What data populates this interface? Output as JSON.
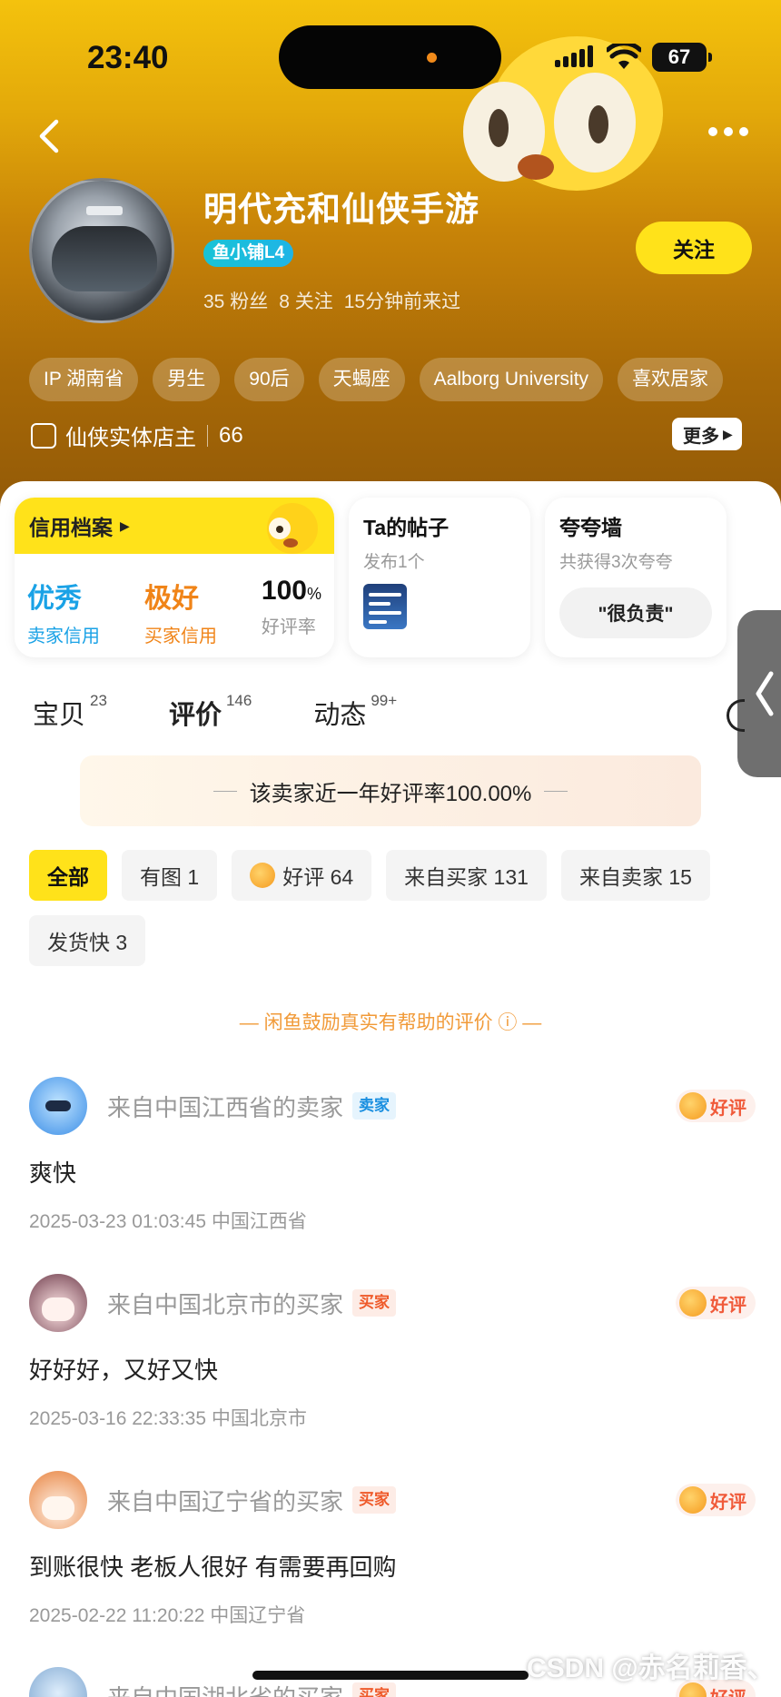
{
  "status_bar": {
    "time": "23:40",
    "battery": "67"
  },
  "profile": {
    "name": "明代充和仙侠手游",
    "level": "鱼小铺L4",
    "stats": [
      "35 粉丝",
      "8 关注",
      "15分钟前来过"
    ],
    "follow_label": "关注",
    "tags": [
      "IP 湖南省",
      "男生",
      "90后",
      "天蝎座",
      "Aalborg University",
      "喜欢居家"
    ],
    "owner_label": "仙侠实体店主",
    "owner_count": "66",
    "more_label": "更多"
  },
  "credit": {
    "title": "信用档案",
    "seller": {
      "value": "优秀",
      "label": "卖家信用"
    },
    "buyer": {
      "value": "极好",
      "label": "买家信用"
    },
    "rate": {
      "value": "100",
      "unit": "%",
      "label": "好评率"
    }
  },
  "posts": {
    "title": "Ta的帖子",
    "sub": "发布1个"
  },
  "praise": {
    "title": "夸夸墙",
    "sub": "共获得3次夸夸",
    "chip": "\"很负责\""
  },
  "tabs": [
    {
      "label": "宝贝",
      "count": "23"
    },
    {
      "label": "评价",
      "count": "146"
    },
    {
      "label": "动态",
      "count": "99+"
    }
  ],
  "rate_banner": "该卖家近一年好评率100.00%",
  "filters": [
    {
      "label": "全部"
    },
    {
      "label": "有图 1"
    },
    {
      "label": "好评 64"
    },
    {
      "label": "来自买家 131"
    },
    {
      "label": "来自卖家 15"
    },
    {
      "label": "发货快 3"
    }
  ],
  "encourage": "— 闲鱼鼓励真实有帮助的评价 ⓘ —",
  "reviews": [
    {
      "from": "来自中国江西省的卖家",
      "role": "卖家",
      "rating": "好评",
      "text": "爽快",
      "meta": "2025-03-23 01:03:45 中国江西省"
    },
    {
      "from": "来自中国北京市的买家",
      "role": "买家",
      "rating": "好评",
      "text": "好好好，又好又快",
      "meta": "2025-03-16 22:33:35 中国北京市"
    },
    {
      "from": "来自中国辽宁省的买家",
      "role": "买家",
      "rating": "好评",
      "text": "到账很快 老板人很好 有需要再回购",
      "meta": "2025-02-22 11:20:22 中国辽宁省"
    },
    {
      "from": "来自中国湖北省的买家",
      "role": "买家",
      "rating": "好评"
    }
  ],
  "watermark": "CSDN @赤名莉香、",
  "colors": {
    "brand_yellow": "#ffe21a",
    "seller_blue": "#1aa2e6",
    "buyer_orange": "#f08418"
  }
}
